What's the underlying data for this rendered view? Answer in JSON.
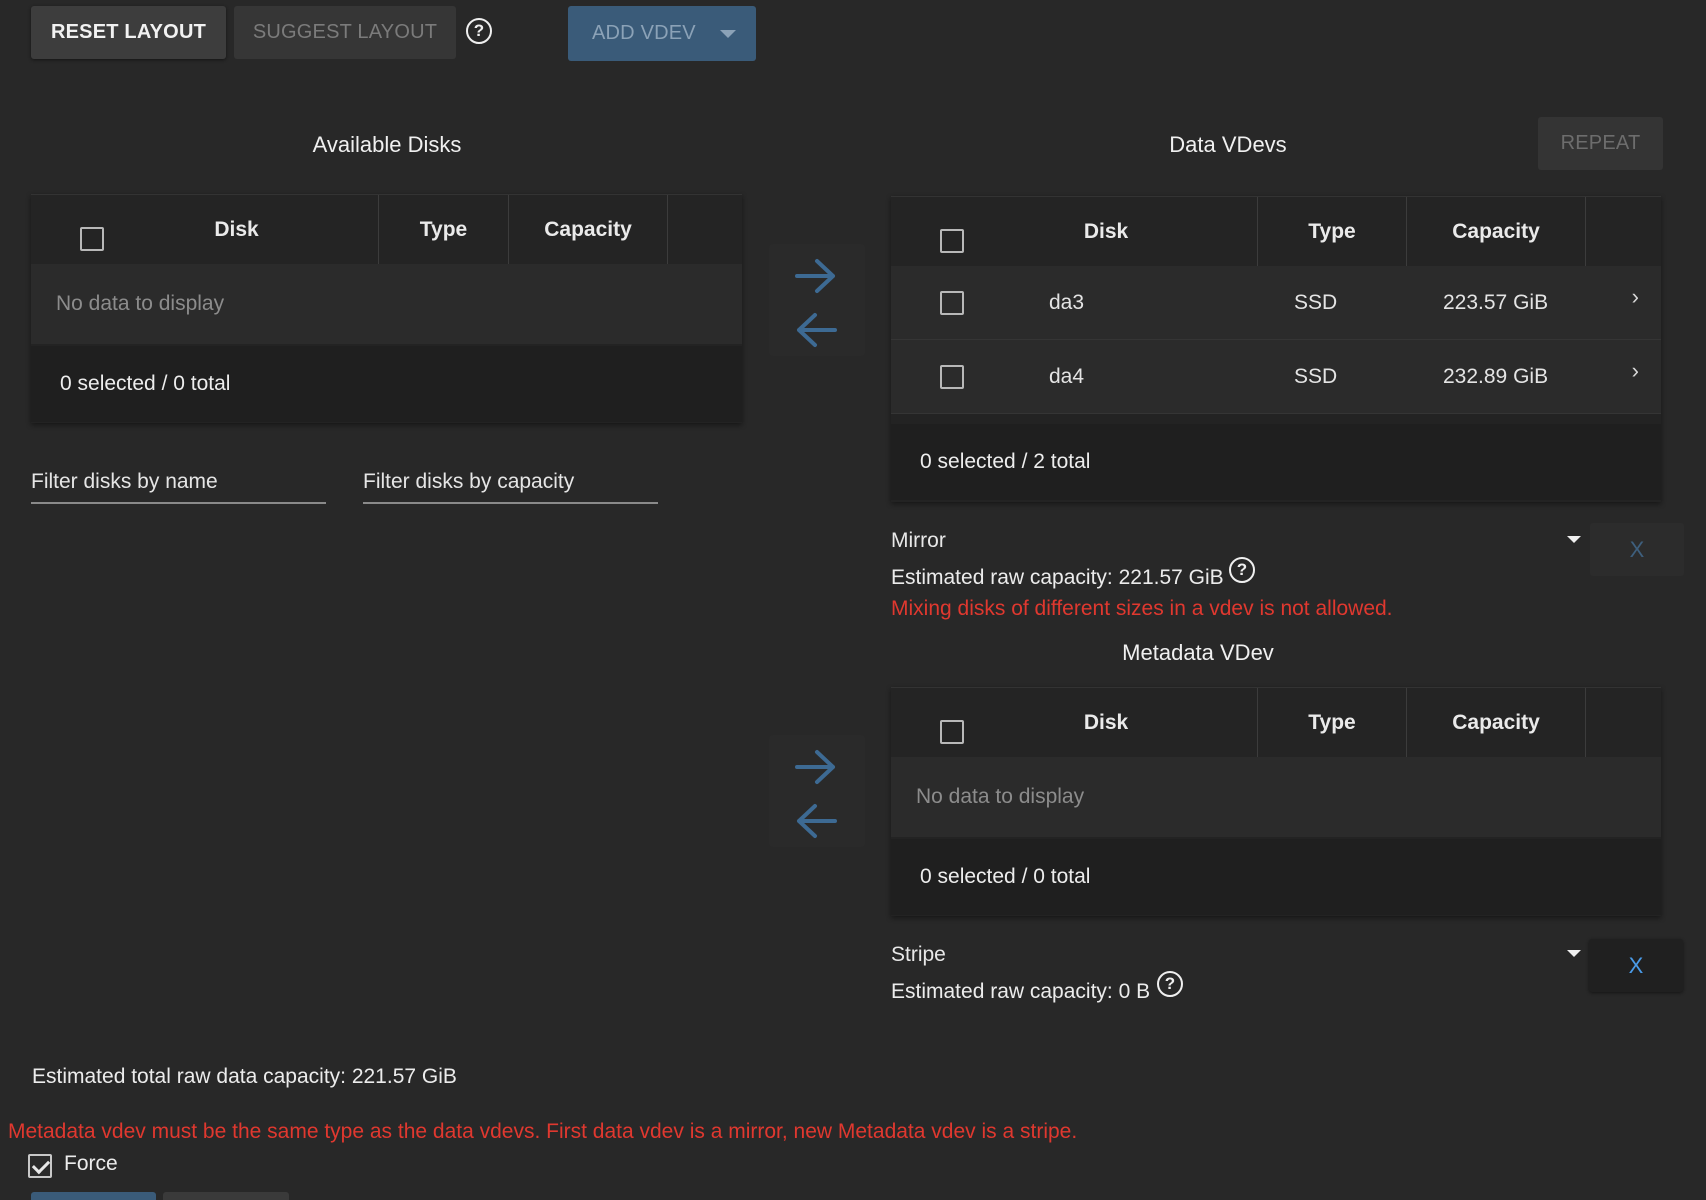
{
  "toolbar": {
    "reset_label": "RESET LAYOUT",
    "suggest_label": "SUGGEST LAYOUT",
    "help": "?",
    "add_vdev_label": "ADD VDEV"
  },
  "available_disks": {
    "title": "Available Disks",
    "columns": [
      "Disk",
      "Type",
      "Capacity"
    ],
    "empty_text": "No data to display",
    "footer": "0 selected / 0 total",
    "filter_name_placeholder": "Filter disks by name",
    "filter_capacity_placeholder": "Filter disks by capacity"
  },
  "data_vdevs": {
    "title": "Data VDevs",
    "repeat_label": "REPEAT",
    "columns": [
      "Disk",
      "Type",
      "Capacity"
    ],
    "rows": [
      {
        "disk": "da3",
        "type": "SSD",
        "capacity": "223.57 GiB",
        "chevron": "›"
      },
      {
        "disk": "da4",
        "type": "SSD",
        "capacity": "232.89 GiB",
        "chevron": "›"
      }
    ],
    "footer": "0 selected / 2 total",
    "vdev_type": "Mirror",
    "estimated": "Estimated raw capacity: 221.57 GiB",
    "error": "Mixing disks of different sizes in a vdev is not allowed.",
    "remove_label": "X"
  },
  "metadata_vdev": {
    "title": "Metadata VDev",
    "columns": [
      "Disk",
      "Type",
      "Capacity"
    ],
    "empty_text": "No data to display",
    "footer": "0 selected / 0 total",
    "vdev_type": "Stripe",
    "estimated": "Estimated raw capacity: 0 B",
    "remove_label": "X"
  },
  "summary": {
    "total_capacity": "Estimated total raw data capacity: 221.57 GiB",
    "error": "Metadata vdev must be the same type as the data vdevs. First data vdev is a mirror, new Metadata vdev is a stripe.",
    "force_label": "Force",
    "force_checked": true
  },
  "colors": {
    "background": "#282828",
    "accent": "#3a5b79",
    "error": "#e0382f",
    "link_blue": "#4a9be8"
  },
  "icons": {
    "move_right": "arrow-right-icon",
    "move_left": "arrow-left-icon",
    "help": "help-circle-icon",
    "dropdown": "caret-down-icon",
    "expand": "chevron-right-icon"
  }
}
